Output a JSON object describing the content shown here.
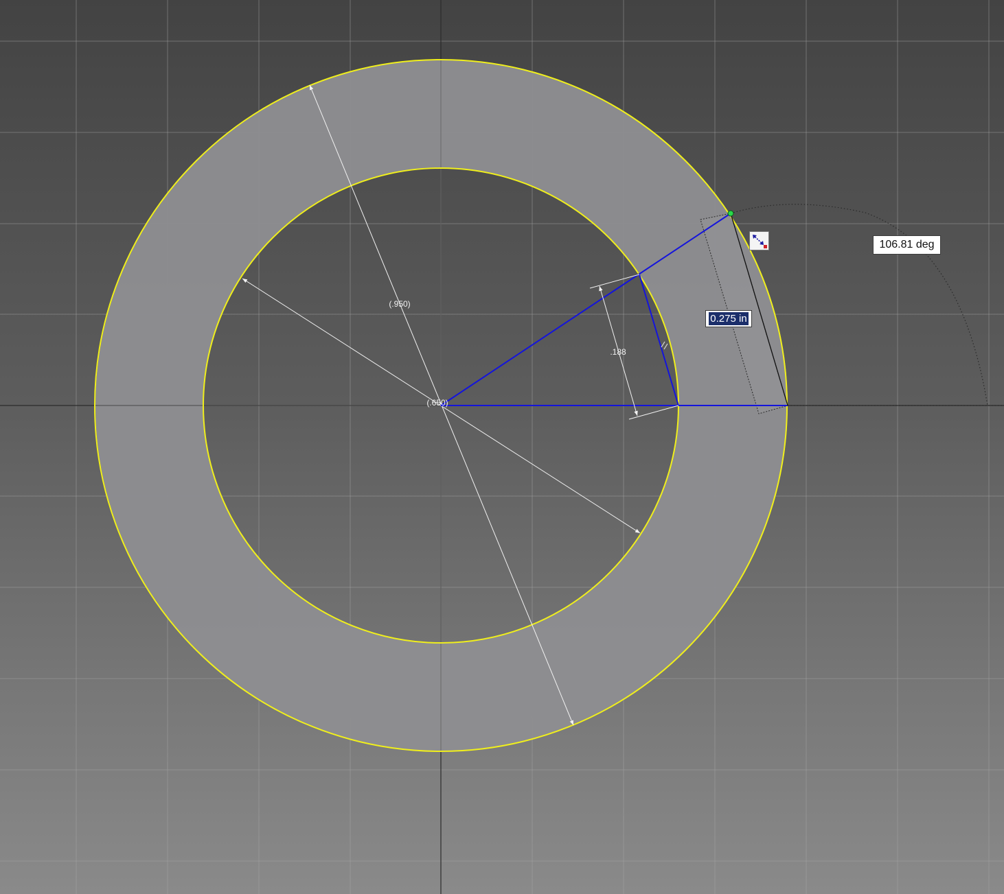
{
  "dimensions": {
    "outer_diameter": "(.950)",
    "inner_diameter": "(.650)",
    "linear_dim": ".188"
  },
  "edit_field": {
    "value": "0.275 in"
  },
  "angle_readout": {
    "value": "106.81 deg"
  },
  "cursor": {
    "icon": "resize-cursor-icon"
  },
  "colors": {
    "sketch_yellow": "#f0ef1c",
    "blue_lines": "#1414dc",
    "fill_gray": "#8d8d91"
  }
}
